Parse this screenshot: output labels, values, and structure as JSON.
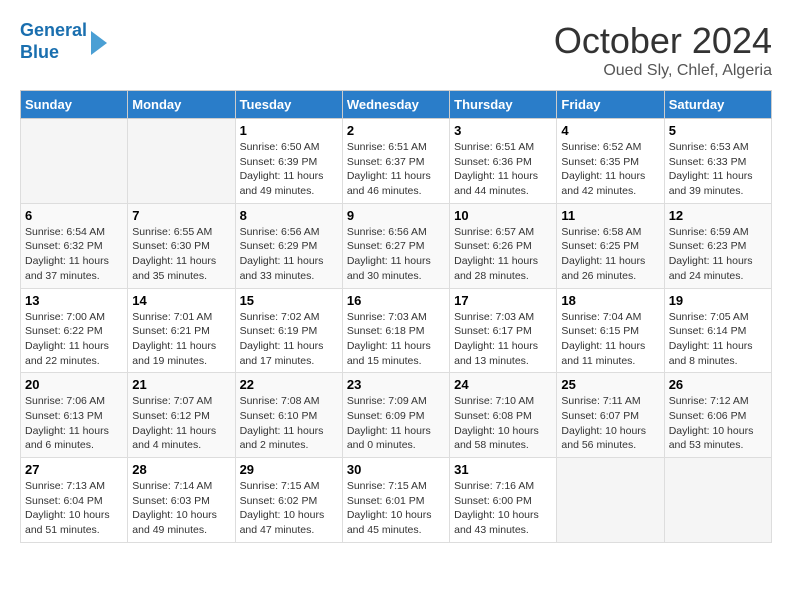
{
  "header": {
    "logo_line1": "General",
    "logo_line2": "Blue",
    "month": "October 2024",
    "location": "Oued Sly, Chlef, Algeria"
  },
  "weekdays": [
    "Sunday",
    "Monday",
    "Tuesday",
    "Wednesday",
    "Thursday",
    "Friday",
    "Saturday"
  ],
  "weeks": [
    [
      {
        "day": "",
        "detail": ""
      },
      {
        "day": "",
        "detail": ""
      },
      {
        "day": "1",
        "detail": "Sunrise: 6:50 AM\nSunset: 6:39 PM\nDaylight: 11 hours and 49 minutes."
      },
      {
        "day": "2",
        "detail": "Sunrise: 6:51 AM\nSunset: 6:37 PM\nDaylight: 11 hours and 46 minutes."
      },
      {
        "day": "3",
        "detail": "Sunrise: 6:51 AM\nSunset: 6:36 PM\nDaylight: 11 hours and 44 minutes."
      },
      {
        "day": "4",
        "detail": "Sunrise: 6:52 AM\nSunset: 6:35 PM\nDaylight: 11 hours and 42 minutes."
      },
      {
        "day": "5",
        "detail": "Sunrise: 6:53 AM\nSunset: 6:33 PM\nDaylight: 11 hours and 39 minutes."
      }
    ],
    [
      {
        "day": "6",
        "detail": "Sunrise: 6:54 AM\nSunset: 6:32 PM\nDaylight: 11 hours and 37 minutes."
      },
      {
        "day": "7",
        "detail": "Sunrise: 6:55 AM\nSunset: 6:30 PM\nDaylight: 11 hours and 35 minutes."
      },
      {
        "day": "8",
        "detail": "Sunrise: 6:56 AM\nSunset: 6:29 PM\nDaylight: 11 hours and 33 minutes."
      },
      {
        "day": "9",
        "detail": "Sunrise: 6:56 AM\nSunset: 6:27 PM\nDaylight: 11 hours and 30 minutes."
      },
      {
        "day": "10",
        "detail": "Sunrise: 6:57 AM\nSunset: 6:26 PM\nDaylight: 11 hours and 28 minutes."
      },
      {
        "day": "11",
        "detail": "Sunrise: 6:58 AM\nSunset: 6:25 PM\nDaylight: 11 hours and 26 minutes."
      },
      {
        "day": "12",
        "detail": "Sunrise: 6:59 AM\nSunset: 6:23 PM\nDaylight: 11 hours and 24 minutes."
      }
    ],
    [
      {
        "day": "13",
        "detail": "Sunrise: 7:00 AM\nSunset: 6:22 PM\nDaylight: 11 hours and 22 minutes."
      },
      {
        "day": "14",
        "detail": "Sunrise: 7:01 AM\nSunset: 6:21 PM\nDaylight: 11 hours and 19 minutes."
      },
      {
        "day": "15",
        "detail": "Sunrise: 7:02 AM\nSunset: 6:19 PM\nDaylight: 11 hours and 17 minutes."
      },
      {
        "day": "16",
        "detail": "Sunrise: 7:03 AM\nSunset: 6:18 PM\nDaylight: 11 hours and 15 minutes."
      },
      {
        "day": "17",
        "detail": "Sunrise: 7:03 AM\nSunset: 6:17 PM\nDaylight: 11 hours and 13 minutes."
      },
      {
        "day": "18",
        "detail": "Sunrise: 7:04 AM\nSunset: 6:15 PM\nDaylight: 11 hours and 11 minutes."
      },
      {
        "day": "19",
        "detail": "Sunrise: 7:05 AM\nSunset: 6:14 PM\nDaylight: 11 hours and 8 minutes."
      }
    ],
    [
      {
        "day": "20",
        "detail": "Sunrise: 7:06 AM\nSunset: 6:13 PM\nDaylight: 11 hours and 6 minutes."
      },
      {
        "day": "21",
        "detail": "Sunrise: 7:07 AM\nSunset: 6:12 PM\nDaylight: 11 hours and 4 minutes."
      },
      {
        "day": "22",
        "detail": "Sunrise: 7:08 AM\nSunset: 6:10 PM\nDaylight: 11 hours and 2 minutes."
      },
      {
        "day": "23",
        "detail": "Sunrise: 7:09 AM\nSunset: 6:09 PM\nDaylight: 11 hours and 0 minutes."
      },
      {
        "day": "24",
        "detail": "Sunrise: 7:10 AM\nSunset: 6:08 PM\nDaylight: 10 hours and 58 minutes."
      },
      {
        "day": "25",
        "detail": "Sunrise: 7:11 AM\nSunset: 6:07 PM\nDaylight: 10 hours and 56 minutes."
      },
      {
        "day": "26",
        "detail": "Sunrise: 7:12 AM\nSunset: 6:06 PM\nDaylight: 10 hours and 53 minutes."
      }
    ],
    [
      {
        "day": "27",
        "detail": "Sunrise: 7:13 AM\nSunset: 6:04 PM\nDaylight: 10 hours and 51 minutes."
      },
      {
        "day": "28",
        "detail": "Sunrise: 7:14 AM\nSunset: 6:03 PM\nDaylight: 10 hours and 49 minutes."
      },
      {
        "day": "29",
        "detail": "Sunrise: 7:15 AM\nSunset: 6:02 PM\nDaylight: 10 hours and 47 minutes."
      },
      {
        "day": "30",
        "detail": "Sunrise: 7:15 AM\nSunset: 6:01 PM\nDaylight: 10 hours and 45 minutes."
      },
      {
        "day": "31",
        "detail": "Sunrise: 7:16 AM\nSunset: 6:00 PM\nDaylight: 10 hours and 43 minutes."
      },
      {
        "day": "",
        "detail": ""
      },
      {
        "day": "",
        "detail": ""
      }
    ]
  ]
}
